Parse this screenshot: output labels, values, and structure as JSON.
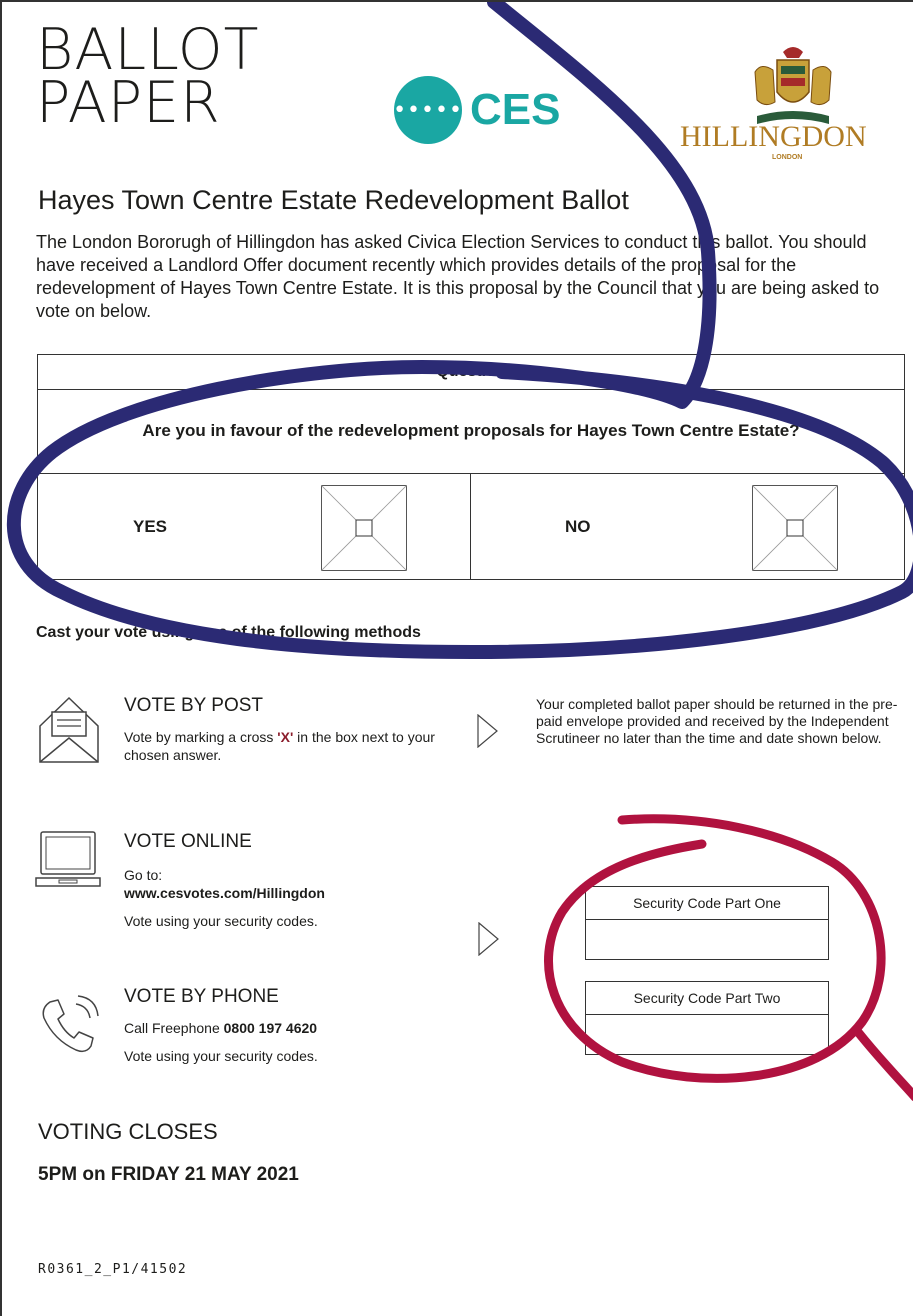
{
  "header": {
    "title_line1": "BALLOT",
    "title_line2": "PAPER",
    "ces_dots": "•••••",
    "ces_text": "CES",
    "council_name": "HILLINGDON",
    "council_sub": "LONDON"
  },
  "heading": "Hayes Town Centre Estate Redevelopment Ballot",
  "intro": "The London Bororugh of Hillingdon has asked Civica Election Services to conduct this ballot. You should have received a Landlord Offer document recently which provides details of the proposal for the redevelopment of Hayes Town Centre Estate. It is this proposal by the Council that you are being asked to vote on below.",
  "question": {
    "header": "Question",
    "text": "Are you in favour of the redevelopment proposals for Hayes Town Centre Estate?",
    "options": [
      "YES",
      "NO"
    ]
  },
  "methods": {
    "heading": "Cast your vote using one of the following methods",
    "post": {
      "title": "VOTE BY POST",
      "text_before": "Vote by marking a cross ",
      "mark": "'X'",
      "text_after": " in the box next to your chosen answer.",
      "return_text": "Your completed ballot paper should be returned in the pre-paid envelope provided and received by the Independent Scrutineer no later than the time and date shown below."
    },
    "online": {
      "title": "VOTE ONLINE",
      "go_to": "Go to:",
      "url": "www.cesvotes.com/Hillingdon",
      "note": "Vote using your security codes."
    },
    "phone": {
      "title": "VOTE BY PHONE",
      "call_text": "Call Freephone ",
      "number": "0800 197 4620",
      "note": "Vote using your security codes."
    }
  },
  "security_codes": {
    "part_one": "Security Code Part One",
    "part_two": "Security Code Part Two"
  },
  "closing": {
    "label": "VOTING CLOSES",
    "date": "5PM on FRIDAY 21 MAY 2021"
  },
  "reference": "R0361_2_P1/41502",
  "colors": {
    "ces_teal": "#1aa7a3",
    "council_gold": "#b07c24",
    "pen_blue": "#2b2a74",
    "pen_red": "#b0123f"
  }
}
